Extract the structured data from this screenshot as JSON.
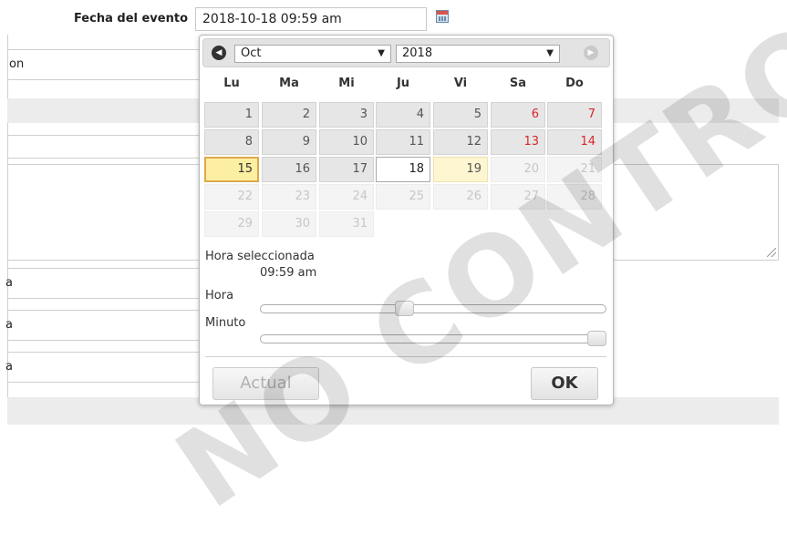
{
  "form": {
    "event_date_label": "Fecha del evento",
    "event_date_value": "2018-10-18 09:59 am",
    "partial_label_1": "on",
    "partial_labels": [
      "a",
      "a",
      "a"
    ]
  },
  "datepicker": {
    "month": "Oct",
    "year": "2018",
    "weekdays": [
      "Lu",
      "Ma",
      "Mi",
      "Ju",
      "Vi",
      "Sa",
      "Do"
    ],
    "weeks": [
      [
        "1",
        "2",
        "3",
        "4",
        "5",
        "6",
        "7"
      ],
      [
        "8",
        "9",
        "10",
        "11",
        "12",
        "13",
        "14"
      ],
      [
        "15",
        "16",
        "17",
        "18",
        "19",
        "20",
        "21"
      ],
      [
        "22",
        "23",
        "24",
        "25",
        "26",
        "27",
        "28"
      ],
      [
        "29",
        "30",
        "31",
        "",
        "",
        "",
        ""
      ]
    ],
    "selected_time_label": "Hora seleccionada",
    "selected_time_value": "09:59 am",
    "hour_label": "Hora",
    "minute_label": "Minuto",
    "hour_level_fraction": 0.41,
    "minute_level_fraction": 1.0,
    "now_button": "Actual",
    "ok_button": "OK",
    "weekend_color": "#d9262c",
    "selected_day": "15",
    "today_day": "18"
  },
  "watermark": "NO CONTROLADO"
}
